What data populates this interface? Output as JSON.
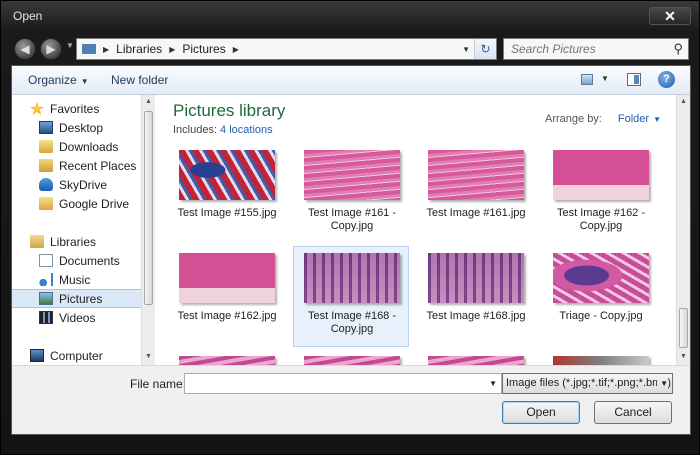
{
  "window": {
    "title": "Open",
    "close_label": "✕"
  },
  "nav": {
    "back_glyph": "◀",
    "forward_glyph": "▶"
  },
  "address": {
    "crumbs": [
      "Libraries",
      "Pictures"
    ]
  },
  "search": {
    "placeholder": "Search Pictures"
  },
  "toolbar": {
    "organize_label": "Organize",
    "new_folder_label": "New folder",
    "help_label": "?"
  },
  "navpane": {
    "items": [
      {
        "label": "Favorites",
        "icon": "star-icon"
      },
      {
        "label": "Desktop",
        "icon": "desktop-icon"
      },
      {
        "label": "Downloads",
        "icon": "downloads-folder-icon"
      },
      {
        "label": "Recent Places",
        "icon": "recent-places-icon"
      },
      {
        "label": "SkyDrive",
        "icon": "cloud-icon"
      },
      {
        "label": "Google Drive",
        "icon": "folder-icon"
      },
      {
        "label": "Libraries",
        "icon": "libraries-icon"
      },
      {
        "label": "Documents",
        "icon": "documents-icon"
      },
      {
        "label": "Music",
        "icon": "music-icon"
      },
      {
        "label": "Pictures",
        "icon": "pictures-icon",
        "selected": true
      },
      {
        "label": "Videos",
        "icon": "videos-icon"
      },
      {
        "label": "Computer",
        "icon": "computer-icon"
      }
    ]
  },
  "library": {
    "title": "Pictures library",
    "includes_label": "Includes:",
    "locations_link": "4 locations",
    "arrange_label": "Arrange by:",
    "arrange_value": "Folder"
  },
  "files": [
    {
      "name": "Test Image #155.jpg",
      "style": "trichrome"
    },
    {
      "name": "Test Image #161 - Copy.jpg",
      "style": "muscle"
    },
    {
      "name": "Test Image #161.jpg",
      "style": "muscle"
    },
    {
      "name": "Test Image #162 - Copy.jpg",
      "style": "muscle-light"
    },
    {
      "name": "Test Image #162.jpg",
      "style": "muscle-light"
    },
    {
      "name": "Test Image #168 - Copy.jpg",
      "style": "villi",
      "selected": true
    },
    {
      "name": "Test Image #168.jpg",
      "style": "villi"
    },
    {
      "name": "Triage - Copy.jpg",
      "style": "triage"
    },
    {
      "name": "",
      "style": "pinkpurple"
    },
    {
      "name": "",
      "style": "pinkpurple"
    },
    {
      "name": "",
      "style": "pinkpurple"
    },
    {
      "name": "",
      "style": "redgrey"
    }
  ],
  "bottom": {
    "file_name_label": "File name:",
    "file_name_value": "",
    "filter_value": "Image files (*.jpg;*.tif;*.png;*.bmp)",
    "open_label": "Open",
    "cancel_label": "Cancel"
  }
}
